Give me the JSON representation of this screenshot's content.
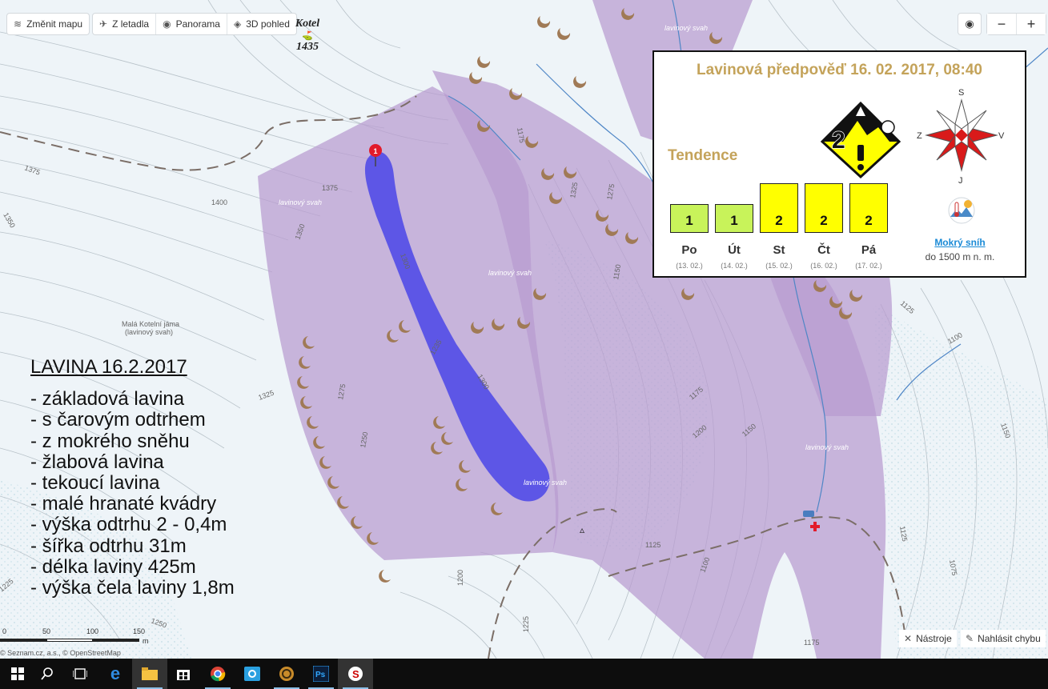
{
  "toolbar": {
    "change_map": "Změnit mapu",
    "aerial": "Z letadla",
    "panorama": "Panorama",
    "view3d": "3D pohled"
  },
  "zoom": {
    "locate_icon": "target-icon",
    "minus": "−",
    "plus": "+"
  },
  "peak": {
    "name": "Kotel",
    "elevation": "1435"
  },
  "map_labels": {
    "slope": "lavinový svah",
    "mala_kotelni": "Malá Kotelní jáma",
    "mala_kotelni_sub": "(lavinový svah)",
    "contours": [
      "1425",
      "1375",
      "1400",
      "1350",
      "1375",
      "1350",
      "1300",
      "1235",
      "1325",
      "1275",
      "1250",
      "1200",
      "1300",
      "1250",
      "1225",
      "1175",
      "1200",
      "1150",
      "1125",
      "1100",
      "1075",
      "1125",
      "1100",
      "1125",
      "1150",
      "1175",
      "1325",
      "1275",
      "1225",
      "1175",
      "1150",
      "1250"
    ]
  },
  "forecast": {
    "title": "Lavinová předpověď 16. 02. 2017, 08:40",
    "current_level": "2",
    "tendency_label": "Tendence",
    "days": [
      {
        "level": "1",
        "day": "Po",
        "date": "(13. 02.)",
        "color": "#c8f35a"
      },
      {
        "level": "1",
        "day": "Út",
        "date": "(14. 02.)",
        "color": "#c8f35a"
      },
      {
        "level": "2",
        "day": "St",
        "date": "(15. 02.)",
        "color": "#ffff00"
      },
      {
        "level": "2",
        "day": "Čt",
        "date": "(16. 02.)",
        "color": "#ffff00"
      },
      {
        "level": "2",
        "day": "Pá",
        "date": "(17. 02.)",
        "color": "#ffff00"
      }
    ],
    "compass": {
      "n": "S",
      "e": "V",
      "s": "J",
      "w": "Z"
    },
    "problem_label": "Mokrý sníh",
    "problem_sub": "do 1500 m n. m."
  },
  "avalanche_text": {
    "title": "LAVINA 16.2.2017",
    "lines": [
      "- základová lavina",
      "- s čarovým odtrhem",
      "- z mokrého sněhu",
      "- žlabová lavina",
      "- tekoucí lavina",
      "- malé hranaté kvádry",
      "- výška odtrhu 2 - 0,4m",
      "- šířka odtrhu 31m",
      "- délka laviny 425m",
      "- výška čela laviny 1,8m"
    ]
  },
  "marker": "1",
  "scale": {
    "t0": "0",
    "t1": "50",
    "t2": "100",
    "t3": "150",
    "unit": "m"
  },
  "copyright": "© Seznam.cz, a.s., © OpenStreetMap",
  "bottom_tools": {
    "tools": "Nástroje",
    "report": "Nahlásit chybu"
  },
  "taskbar": [
    "windows-start-icon",
    "search-icon",
    "task-view-icon",
    "edge-icon",
    "file-explorer-icon",
    "store-icon",
    "chrome-icon",
    "outlook-icon",
    "app-icon",
    "photoshop-icon",
    "seznam-icon"
  ]
}
